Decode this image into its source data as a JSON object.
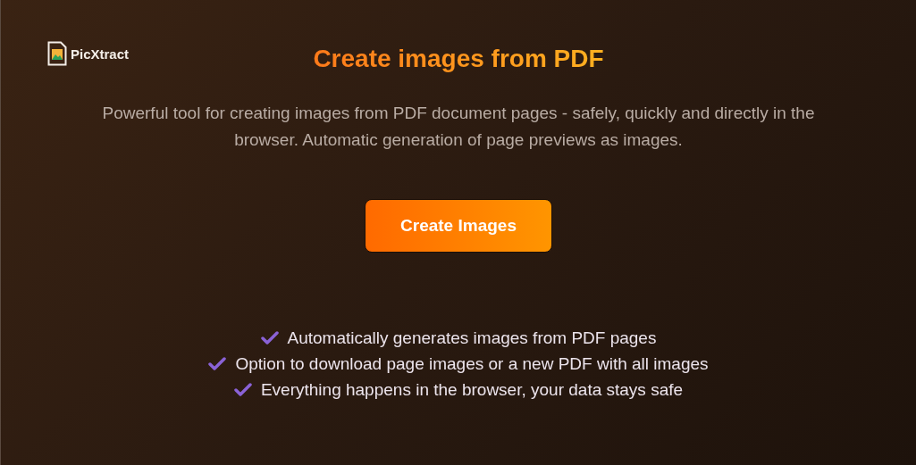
{
  "logo": {
    "name": "PicXtract"
  },
  "title": "Create images from PDF",
  "subtitle": "Powerful tool for creating images from PDF document pages - safely, quickly and directly in the browser. Automatic generation of page previews as images.",
  "cta_button": "Create Images",
  "features": [
    "Automatically generates images from PDF pages",
    "Option to download page images or a new PDF with all images",
    "Everything happens in the browser, your data stays safe"
  ]
}
